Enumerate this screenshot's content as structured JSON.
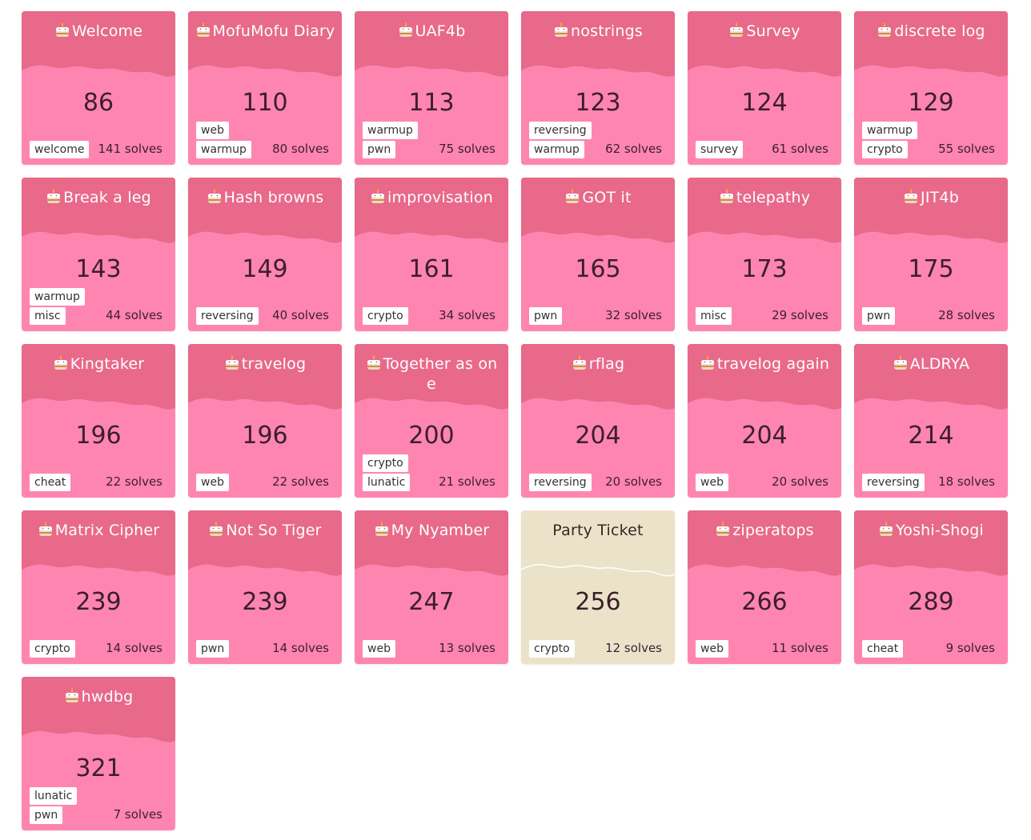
{
  "colors": {
    "card_unsolved": "#ff85b1",
    "card_unsolved_header": "#e8698a",
    "card_solved": "#ebe3c9",
    "tag_background": "#ffffff",
    "points_text": "#3b1f2b"
  },
  "challenges": [
    {
      "name": "Welcome",
      "points": "86",
      "tags": [
        "welcome"
      ],
      "solves": "141 solves",
      "solved": false
    },
    {
      "name": "MofuMofu Diary",
      "points": "110",
      "tags": [
        "web",
        "warmup"
      ],
      "solves": "80 solves",
      "solved": false
    },
    {
      "name": "UAF4b",
      "points": "113",
      "tags": [
        "warmup",
        "pwn"
      ],
      "solves": "75 solves",
      "solved": false
    },
    {
      "name": "nostrings",
      "points": "123",
      "tags": [
        "reversing",
        "warmup"
      ],
      "solves": "62 solves",
      "solved": false
    },
    {
      "name": "Survey",
      "points": "124",
      "tags": [
        "survey"
      ],
      "solves": "61 solves",
      "solved": false
    },
    {
      "name": "discrete log",
      "points": "129",
      "tags": [
        "warmup",
        "crypto"
      ],
      "solves": "55 solves",
      "solved": false
    },
    {
      "name": "Break a leg",
      "points": "143",
      "tags": [
        "warmup",
        "misc"
      ],
      "solves": "44 solves",
      "solved": false
    },
    {
      "name": "Hash browns",
      "points": "149",
      "tags": [
        "reversing"
      ],
      "solves": "40 solves",
      "solved": false
    },
    {
      "name": "improvisation",
      "points": "161",
      "tags": [
        "crypto"
      ],
      "solves": "34 solves",
      "solved": false
    },
    {
      "name": "GOT it",
      "points": "165",
      "tags": [
        "pwn"
      ],
      "solves": "32 solves",
      "solved": false
    },
    {
      "name": "telepathy",
      "points": "173",
      "tags": [
        "misc"
      ],
      "solves": "29 solves",
      "solved": false
    },
    {
      "name": "JIT4b",
      "points": "175",
      "tags": [
        "pwn"
      ],
      "solves": "28 solves",
      "solved": false
    },
    {
      "name": "Kingtaker",
      "points": "196",
      "tags": [
        "cheat"
      ],
      "solves": "22 solves",
      "solved": false
    },
    {
      "name": "travelog",
      "points": "196",
      "tags": [
        "web"
      ],
      "solves": "22 solves",
      "solved": false
    },
    {
      "name": "Together as one",
      "points": "200",
      "tags": [
        "crypto",
        "lunatic"
      ],
      "solves": "21 solves",
      "solved": false
    },
    {
      "name": "rflag",
      "points": "204",
      "tags": [
        "reversing"
      ],
      "solves": "20 solves",
      "solved": false
    },
    {
      "name": "travelog again",
      "points": "204",
      "tags": [
        "web"
      ],
      "solves": "20 solves",
      "solved": false
    },
    {
      "name": "ALDRYA",
      "points": "214",
      "tags": [
        "reversing"
      ],
      "solves": "18 solves",
      "solved": false
    },
    {
      "name": "Matrix Cipher",
      "points": "239",
      "tags": [
        "crypto"
      ],
      "solves": "14 solves",
      "solved": false
    },
    {
      "name": "Not So Tiger",
      "points": "239",
      "tags": [
        "pwn"
      ],
      "solves": "14 solves",
      "solved": false
    },
    {
      "name": "My Nyamber",
      "points": "247",
      "tags": [
        "web"
      ],
      "solves": "13 solves",
      "solved": false
    },
    {
      "name": "Party Ticket",
      "points": "256",
      "tags": [
        "crypto"
      ],
      "solves": "12 solves",
      "solved": true
    },
    {
      "name": "ziperatops",
      "points": "266",
      "tags": [
        "web"
      ],
      "solves": "11 solves",
      "solved": false
    },
    {
      "name": "Yoshi-Shogi",
      "points": "289",
      "tags": [
        "cheat"
      ],
      "solves": "9 solves",
      "solved": false
    },
    {
      "name": "hwdbg",
      "points": "321",
      "tags": [
        "lunatic",
        "pwn"
      ],
      "solves": "7 solves",
      "solved": false
    }
  ]
}
